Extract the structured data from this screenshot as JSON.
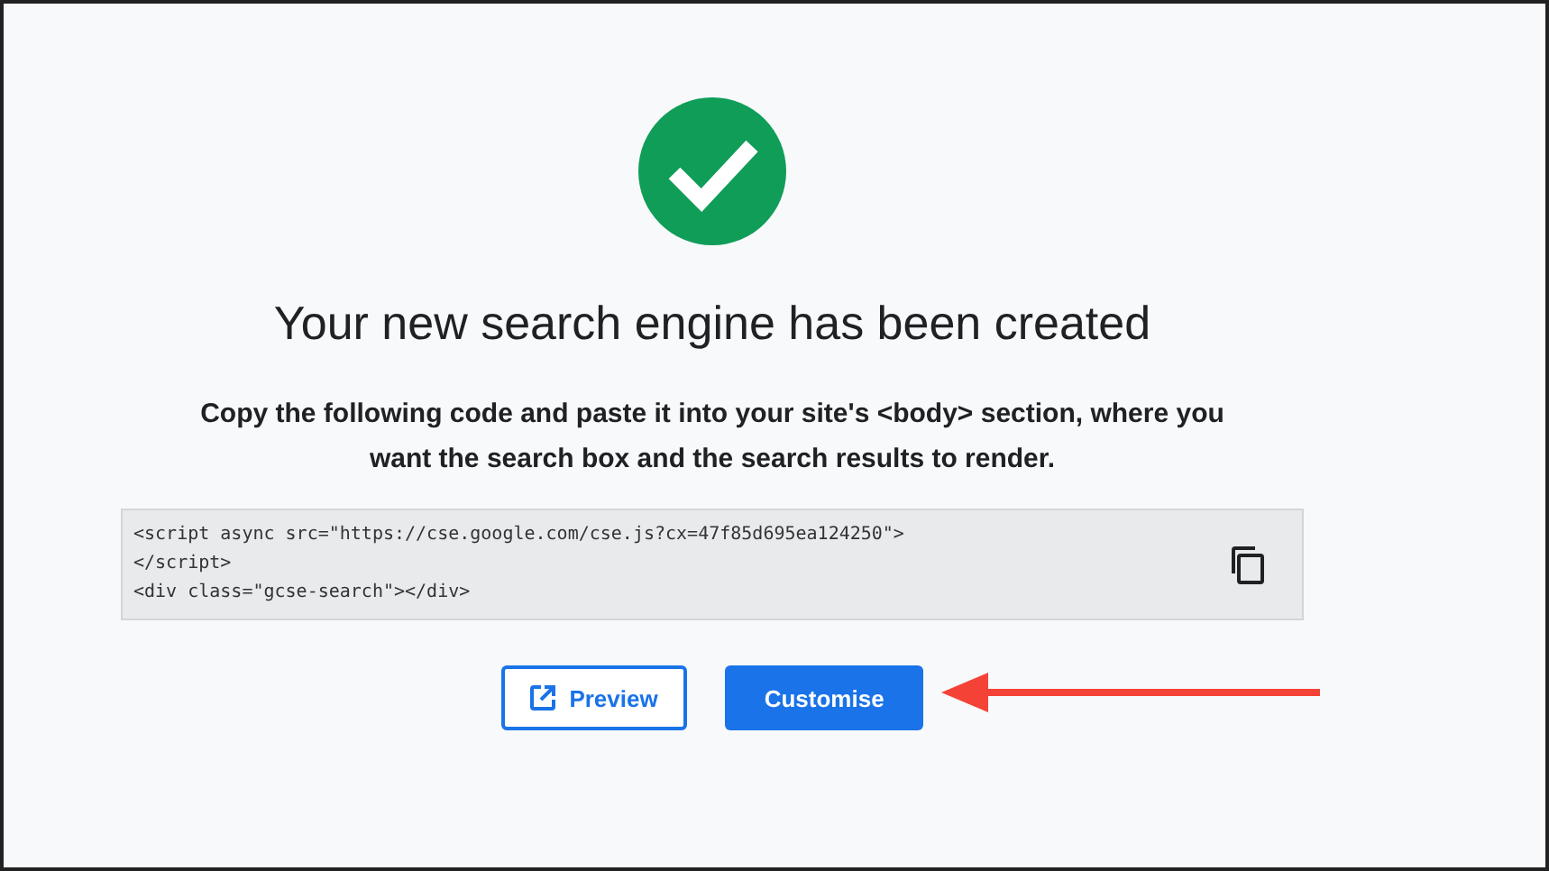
{
  "title": "Your new search engine has been created",
  "instructions": "Copy the following code and paste it into your site's <body> section, where you want the search box and the search results to render.",
  "code_lines": [
    "<script async src=\"https://cse.google.com/cse.js?cx=47f85d695ea124250\">",
    "</script>",
    "<div class=\"gcse-search\"></div>"
  ],
  "buttons": [
    {
      "label": "Preview",
      "kind": "outlined"
    },
    {
      "label": "Customise",
      "kind": "filled"
    }
  ]
}
